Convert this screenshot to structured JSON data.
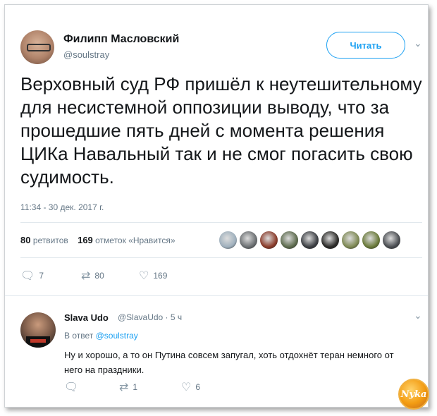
{
  "tweet": {
    "author_name": "Филипп Масловский",
    "author_handle": "@soulstray",
    "follow_label": "Читать",
    "text": "Верховный суд РФ пришёл к неутешительному для несистемной оппозиции выводу, что за прошедшие пять дней с момента решения ЦИКа Навальный так и не смог погасить свою судимость.",
    "timestamp": "11:34 - 30 дек. 2017 г.",
    "retweets_count": "80",
    "retweets_label": "ретвитов",
    "likes_count": "169",
    "likes_label": "отметок «Нравится»",
    "liker_colors": [
      "#9fb0bd",
      "#6b6f72",
      "#8a3b2a",
      "#5d6b4e",
      "#3c3f44",
      "#2b2a28",
      "#7f8a55",
      "#6a7a3a",
      "#4a4d52"
    ],
    "actions": {
      "reply_count": "7",
      "retweet_count": "80",
      "like_count": "169"
    }
  },
  "reply": {
    "author_name": "Slava Udo",
    "author_handle": "@SlavaUdo · 5 ч",
    "reply_to_prefix": "В ответ",
    "reply_to_handle": "@soulstray",
    "text": "Ну и хорошо, а то он Путина совсем запугал, хоть отдохнёт теран немного от него на праздники.",
    "actions": {
      "retweet_count": "1",
      "like_count": "6"
    }
  },
  "watermark": {
    "logo_text": "Nyka"
  },
  "colors": {
    "accent": "#1da1f2",
    "muted": "#657786",
    "border": "#e1e8ed"
  },
  "icons": {
    "reply": "reply-icon",
    "retweet": "retweet-icon",
    "like": "heart-icon",
    "menu": "chevron-down-icon"
  }
}
